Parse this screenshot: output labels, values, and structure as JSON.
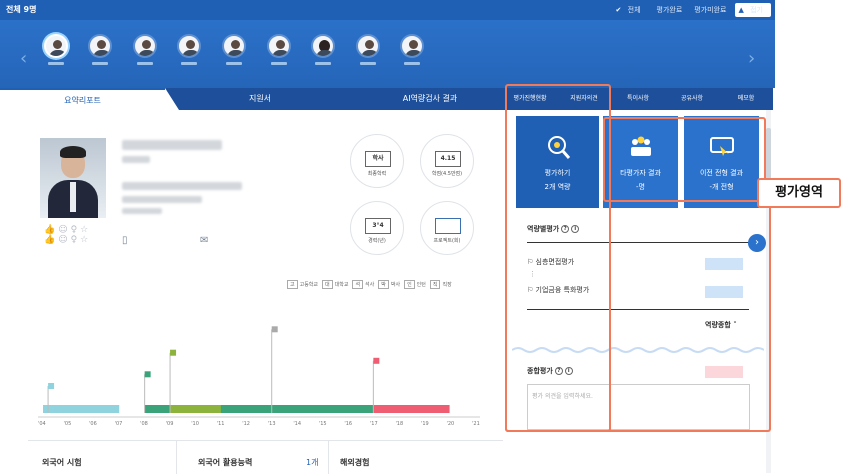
{
  "topbar": {
    "title": "전체 9명",
    "filters": [
      "전체",
      "평가완료",
      "평가미완료",
      "접기"
    ]
  },
  "candidates": {
    "count": 9,
    "selected_index": 0,
    "prev_icon": "chevron-left-icon",
    "next_icon": "chevron-right-icon"
  },
  "tabs": [
    "요약리포트",
    "지원서",
    "AI역량검사 결과"
  ],
  "profile": {
    "icons": [
      "resume-icon",
      "mail-icon"
    ]
  },
  "summary_cards": [
    {
      "value": "학사",
      "label": "최종학력"
    },
    {
      "value": "4.15",
      "label": "학점(4.5만점)"
    },
    {
      "value": "3°4",
      "label": "경력(년)"
    },
    {
      "value": "",
      "label": "프로젝트(회)"
    }
  ],
  "legend": [
    {
      "code": "고",
      "label": "고등학교"
    },
    {
      "code": "대",
      "label": "대학교"
    },
    {
      "code": "석",
      "label": "석사"
    },
    {
      "code": "박",
      "label": "박사"
    },
    {
      "code": "인",
      "label": "인턴"
    },
    {
      "code": "직",
      "label": "직장"
    }
  ],
  "chart_data": {
    "type": "bar",
    "x_ticks": [
      "'04",
      "'05",
      "'06",
      "'07",
      "'08",
      "'09",
      "'10",
      "'11",
      "'12",
      "'13",
      "'14",
      "'15",
      "'16",
      "'17",
      "'18",
      "'19",
      "'20",
      "'21"
    ],
    "series": [
      {
        "type": "고",
        "start": 2004,
        "end": 2007,
        "color": "#8fd3df"
      },
      {
        "type": "대",
        "start": 2008,
        "end": 2017,
        "color": "#3aa37a"
      },
      {
        "type": "인",
        "start": 2009,
        "end": 2011,
        "color": "#8cb43c"
      },
      {
        "type": "직",
        "start": 2017,
        "end": 2020,
        "color": "#ef5d72"
      }
    ],
    "markers": [
      {
        "year": 2004.2,
        "level": 0.3,
        "color": "#8fd3df"
      },
      {
        "year": 2008,
        "level": 0.43,
        "color": "#3aa37a"
      },
      {
        "year": 2009,
        "level": 0.67,
        "color": "#8cb43c"
      },
      {
        "year": 2013,
        "level": 0.93,
        "color": "#aaaaaa"
      },
      {
        "year": 2017,
        "level": 0.58,
        "color": "#ef5d72"
      }
    ]
  },
  "bottom": {
    "foreign_test": "외국어 시험",
    "foreign_ability": "외국어 활용능력",
    "foreign_count": "1개",
    "overseas": "해외경험"
  },
  "right_tabs": [
    "평가진행현황",
    "지원자의견",
    "특이사항",
    "공유사항",
    "메모함"
  ],
  "eval_cards": [
    {
      "title": "평가하기",
      "sub": "2개 역량",
      "icon": "evaluate-icon"
    },
    {
      "title": "타평가자 결과",
      "sub": "-명",
      "icon": "evaluators-icon"
    },
    {
      "title": "이전 전형 결과",
      "sub": "-개 전형",
      "icon": "previous-result-icon"
    }
  ],
  "callout": "평가영역",
  "competency": {
    "title": "역량별평가",
    "items": [
      "심층면접평가",
      "기업금융 특화평가"
    ],
    "total_label": "역량종합"
  },
  "overall": {
    "title": "종합평가",
    "placeholder": "평가 의견을 입력하세요."
  },
  "colors": {
    "primary": "#1f5fb4",
    "highlight": "#f07a5a"
  }
}
